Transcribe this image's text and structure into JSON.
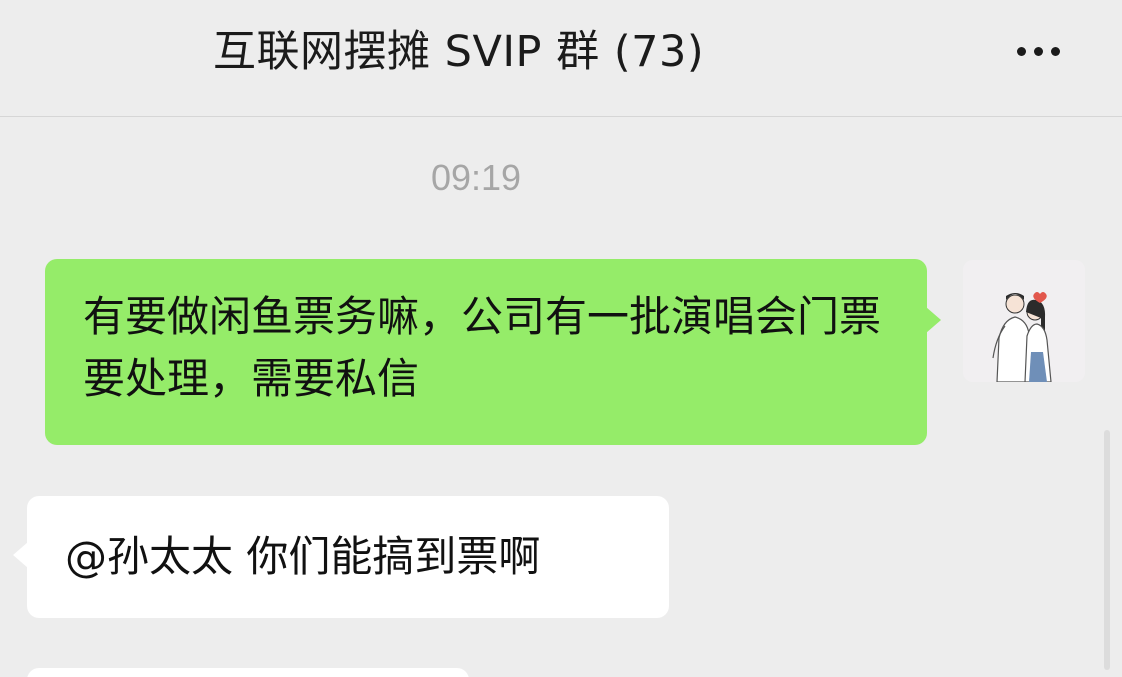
{
  "header": {
    "title": "互联网摆摊 SVIP 群 (73)",
    "more_icon": "more-dots-icon"
  },
  "chat": {
    "timestamp": "09:19",
    "messages": [
      {
        "direction": "outgoing",
        "text": "有要做闲鱼票务嘛，公司有一批演唱会门票要处理，需要私信",
        "avatar": "couple-illustration-avatar"
      },
      {
        "direction": "incoming",
        "text": "@孙太太 你们能搞到票啊"
      }
    ]
  },
  "colors": {
    "background": "#ededed",
    "outgoing_bubble": "#95ec69",
    "incoming_bubble": "#ffffff",
    "timestamp": "#a6a6a6"
  }
}
